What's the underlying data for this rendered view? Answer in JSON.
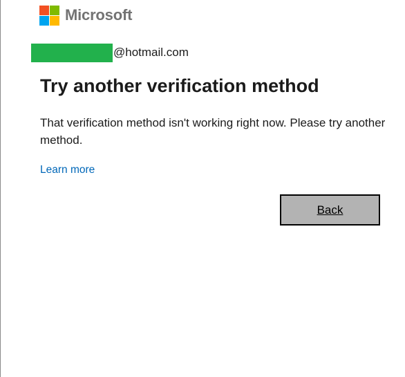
{
  "brand": {
    "name": "Microsoft",
    "squares": {
      "red": "#f25022",
      "green": "#7fba00",
      "blue": "#00a4ef",
      "yellow": "#ffb900"
    }
  },
  "identity": {
    "email_suffix": "@hotmail.com",
    "redaction_color": "#22b14c"
  },
  "main": {
    "title": "Try another verification method",
    "description": "That verification method isn't working right now. Please try another method.",
    "learn_more_label": "Learn more",
    "back_label": "Back"
  },
  "colors": {
    "link": "#0067b8",
    "button_bg": "#b3b3b3"
  }
}
